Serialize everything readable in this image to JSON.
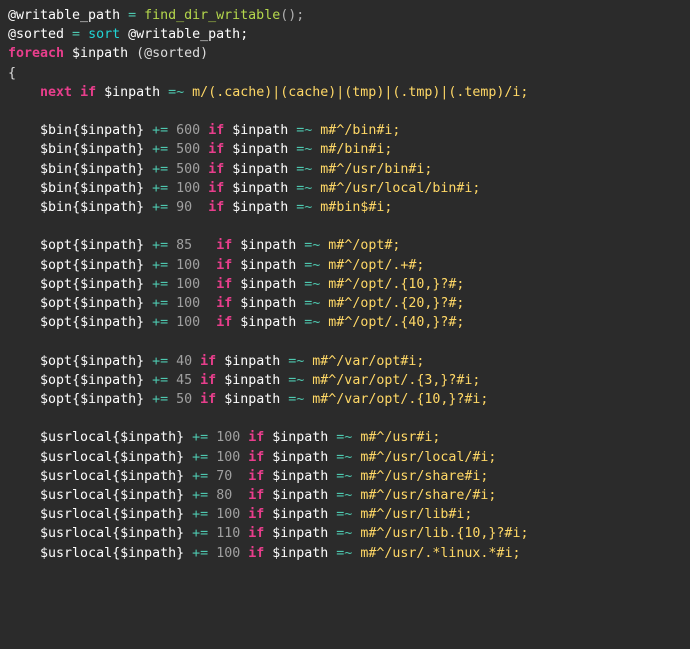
{
  "code": {
    "l1": {
      "a": "@writable_path",
      "b": " = ",
      "c": "find_dir_writable",
      "d": "();"
    },
    "l2": {
      "a": "@sorted",
      "b": " = ",
      "c": "sort",
      "d": " @writable_path;"
    },
    "l3": {
      "a": "foreach",
      "b": " $inpath ",
      "c": "(@sorted)"
    },
    "l4": "{",
    "l5": {
      "ind": "    ",
      "a": "next",
      "b": " if",
      "c": " $inpath ",
      "d": "=~",
      "e": " m/",
      "f": "(.cache)|(cache)|(tmp)|(.tmp)|(.temp)",
      "g": "/i;"
    },
    "g1": [
      {
        "h": "$bin",
        "k": "{$inpath}",
        "op": " += ",
        "n": "600",
        "if": " if ",
        "v": "$inpath ",
        "tl": "=~",
        "m": " m#",
        "r": "^/bin#",
        "fl": "i;"
      },
      {
        "h": "$bin",
        "k": "{$inpath}",
        "op": " += ",
        "n": "500",
        "if": " if ",
        "v": "$inpath ",
        "tl": "=~",
        "m": " m#",
        "r": "/bin#",
        "fl": "i;"
      },
      {
        "h": "$bin",
        "k": "{$inpath}",
        "op": " += ",
        "n": "500",
        "if": " if ",
        "v": "$inpath ",
        "tl": "=~",
        "m": " m#",
        "r": "^/usr/bin#",
        "fl": "i;"
      },
      {
        "h": "$bin",
        "k": "{$inpath}",
        "op": " += ",
        "n": "100",
        "if": " if ",
        "v": "$inpath ",
        "tl": "=~",
        "m": " m#",
        "r": "^/usr/local/bin#",
        "fl": "i;"
      },
      {
        "h": "$bin",
        "k": "{$inpath}",
        "op": " += ",
        "n": "90 ",
        "if": " if ",
        "v": "$inpath ",
        "tl": "=~",
        "m": " m#",
        "r": "bin$#",
        "fl": "i;"
      }
    ],
    "g2": [
      {
        "h": "$opt",
        "k": "{$inpath}",
        "op": " += ",
        "n": "85 ",
        "if": "  if ",
        "v": "$inpath ",
        "tl": "=~",
        "m": " m#",
        "r": "^/opt#",
        "fl": ";"
      },
      {
        "h": "$opt",
        "k": "{$inpath}",
        "op": " += ",
        "n": "100",
        "if": "  if ",
        "v": "$inpath ",
        "tl": "=~",
        "m": " m#",
        "r": "^/opt/.+#",
        "fl": ";"
      },
      {
        "h": "$opt",
        "k": "{$inpath}",
        "op": " += ",
        "n": "100",
        "if": "  if ",
        "v": "$inpath ",
        "tl": "=~",
        "m": " m#",
        "r": "^/opt/.{10,}?#",
        "fl": ";"
      },
      {
        "h": "$opt",
        "k": "{$inpath}",
        "op": " += ",
        "n": "100",
        "if": "  if ",
        "v": "$inpath ",
        "tl": "=~",
        "m": " m#",
        "r": "^/opt/.{20,}?#",
        "fl": ";"
      },
      {
        "h": "$opt",
        "k": "{$inpath}",
        "op": " += ",
        "n": "100",
        "if": "  if ",
        "v": "$inpath ",
        "tl": "=~",
        "m": " m#",
        "r": "^/opt/.{40,}?#",
        "fl": ";"
      }
    ],
    "g3": [
      {
        "h": "$opt",
        "k": "{$inpath}",
        "op": " += ",
        "n": "40",
        "if": " if ",
        "v": "$inpath ",
        "tl": "=~",
        "m": " m#",
        "r": "^/var/opt#",
        "fl": "i;"
      },
      {
        "h": "$opt",
        "k": "{$inpath}",
        "op": " += ",
        "n": "45",
        "if": " if ",
        "v": "$inpath ",
        "tl": "=~",
        "m": " m#",
        "r": "^/var/opt/.{3,}?#",
        "fl": "i;"
      },
      {
        "h": "$opt",
        "k": "{$inpath}",
        "op": " += ",
        "n": "50",
        "if": " if ",
        "v": "$inpath ",
        "tl": "=~",
        "m": " m#",
        "r": "^/var/opt/.{10,}?#",
        "fl": "i;"
      }
    ],
    "g4": [
      {
        "h": "$usrlocal",
        "k": "{$inpath}",
        "op": " += ",
        "n": "100",
        "if": " if ",
        "v": "$inpath ",
        "tl": "=~",
        "m": " m#",
        "r": "^/usr#",
        "fl": "i;"
      },
      {
        "h": "$usrlocal",
        "k": "{$inpath}",
        "op": " += ",
        "n": "100",
        "if": " if ",
        "v": "$inpath ",
        "tl": "=~",
        "m": " m#",
        "r": "^/usr/local/#",
        "fl": "i;"
      },
      {
        "h": "$usrlocal",
        "k": "{$inpath}",
        "op": " += ",
        "n": "70 ",
        "if": " if ",
        "v": "$inpath ",
        "tl": "=~",
        "m": " m#",
        "r": "^/usr/share#",
        "fl": "i;"
      },
      {
        "h": "$usrlocal",
        "k": "{$inpath}",
        "op": " += ",
        "n": "80 ",
        "if": " if ",
        "v": "$inpath ",
        "tl": "=~",
        "m": " m#",
        "r": "^/usr/share/#",
        "fl": "i;"
      },
      {
        "h": "$usrlocal",
        "k": "{$inpath}",
        "op": " += ",
        "n": "100",
        "if": " if ",
        "v": "$inpath ",
        "tl": "=~",
        "m": " m#",
        "r": "^/usr/lib#",
        "fl": "i;"
      },
      {
        "h": "$usrlocal",
        "k": "{$inpath}",
        "op": " += ",
        "n": "110",
        "if": " if ",
        "v": "$inpath ",
        "tl": "=~",
        "m": " m#",
        "r": "^/usr/lib.{10,}?#",
        "fl": "i;"
      },
      {
        "h": "$usrlocal",
        "k": "{$inpath}",
        "op": " += ",
        "n": "100",
        "if": " if ",
        "v": "$inpath ",
        "tl": "=~",
        "m": " m#",
        "r": "^/usr/.*linux.*#",
        "fl": "i;"
      }
    ]
  }
}
